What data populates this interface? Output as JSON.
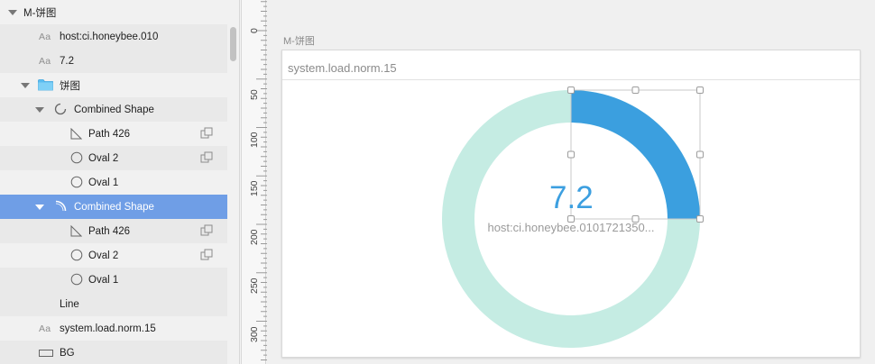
{
  "layers": {
    "items": [
      {
        "label": "M-饼图"
      },
      {
        "label": "host:ci.honeybee.010",
        "icon_text": "Aa"
      },
      {
        "label": "7.2",
        "icon_text": "Aa"
      },
      {
        "label": "饼图"
      },
      {
        "label": "Combined Shape"
      },
      {
        "label": "Path 426"
      },
      {
        "label": "Oval 2"
      },
      {
        "label": "Oval 1"
      },
      {
        "label": "Combined Shape"
      },
      {
        "label": "Path 426"
      },
      {
        "label": "Oval 2"
      },
      {
        "label": "Oval 1"
      },
      {
        "label": "Line"
      },
      {
        "label": "system.load.norm.15",
        "icon_text": "Aa"
      },
      {
        "label": "BG"
      }
    ]
  },
  "ruler": {
    "labels": [
      "0",
      "50",
      "100",
      "150",
      "200",
      "250",
      "300"
    ]
  },
  "artboard": {
    "name": "M-饼图",
    "panel_title": "system.load.norm.15",
    "value": "7.2",
    "host_label": "host:ci.honeybee.0101721350..."
  },
  "colors": {
    "ring_background": "#c5ece3",
    "ring_value": "#3b9fdf",
    "selection": "#6f9ee6",
    "value_text": "#3c9fe0"
  },
  "chart_data": {
    "type": "pie",
    "value_fraction": 0.25
  }
}
